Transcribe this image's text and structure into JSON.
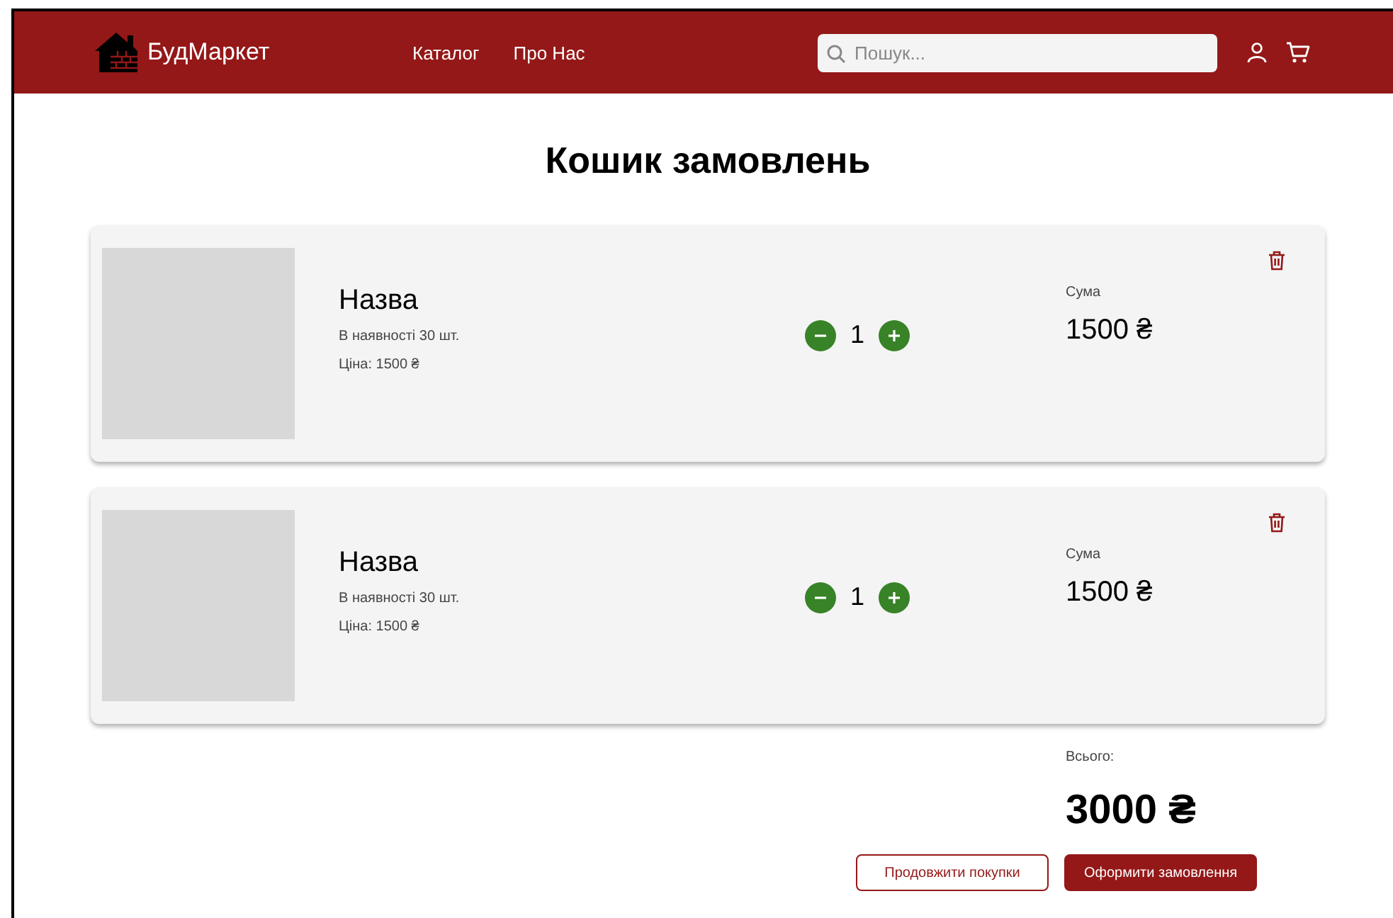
{
  "header": {
    "brand": "БудМаркет",
    "nav": [
      "Каталог",
      "Про Нас"
    ],
    "search": {
      "placeholder": "Пошук..."
    }
  },
  "title": "Кошик замовлень",
  "items": [
    {
      "name": "Назва",
      "stock": "В наявності 30 шт.",
      "price": "Ціна: 1500 ₴",
      "quantity": "1",
      "sum_label": "Сума",
      "sum": "1500 ₴"
    },
    {
      "name": "Назва",
      "stock": "В наявності 30 шт.",
      "price": "Ціна: 1500 ₴",
      "quantity": "1",
      "sum_label": "Сума",
      "sum": "1500 ₴"
    }
  ],
  "total": {
    "label": "Всього:",
    "value": "3000 ₴"
  },
  "buttons": [
    {
      "kind": "outline",
      "label": "Продовжити покупки"
    },
    {
      "kind": "primary",
      "label": "Оформити замовлення"
    }
  ]
}
